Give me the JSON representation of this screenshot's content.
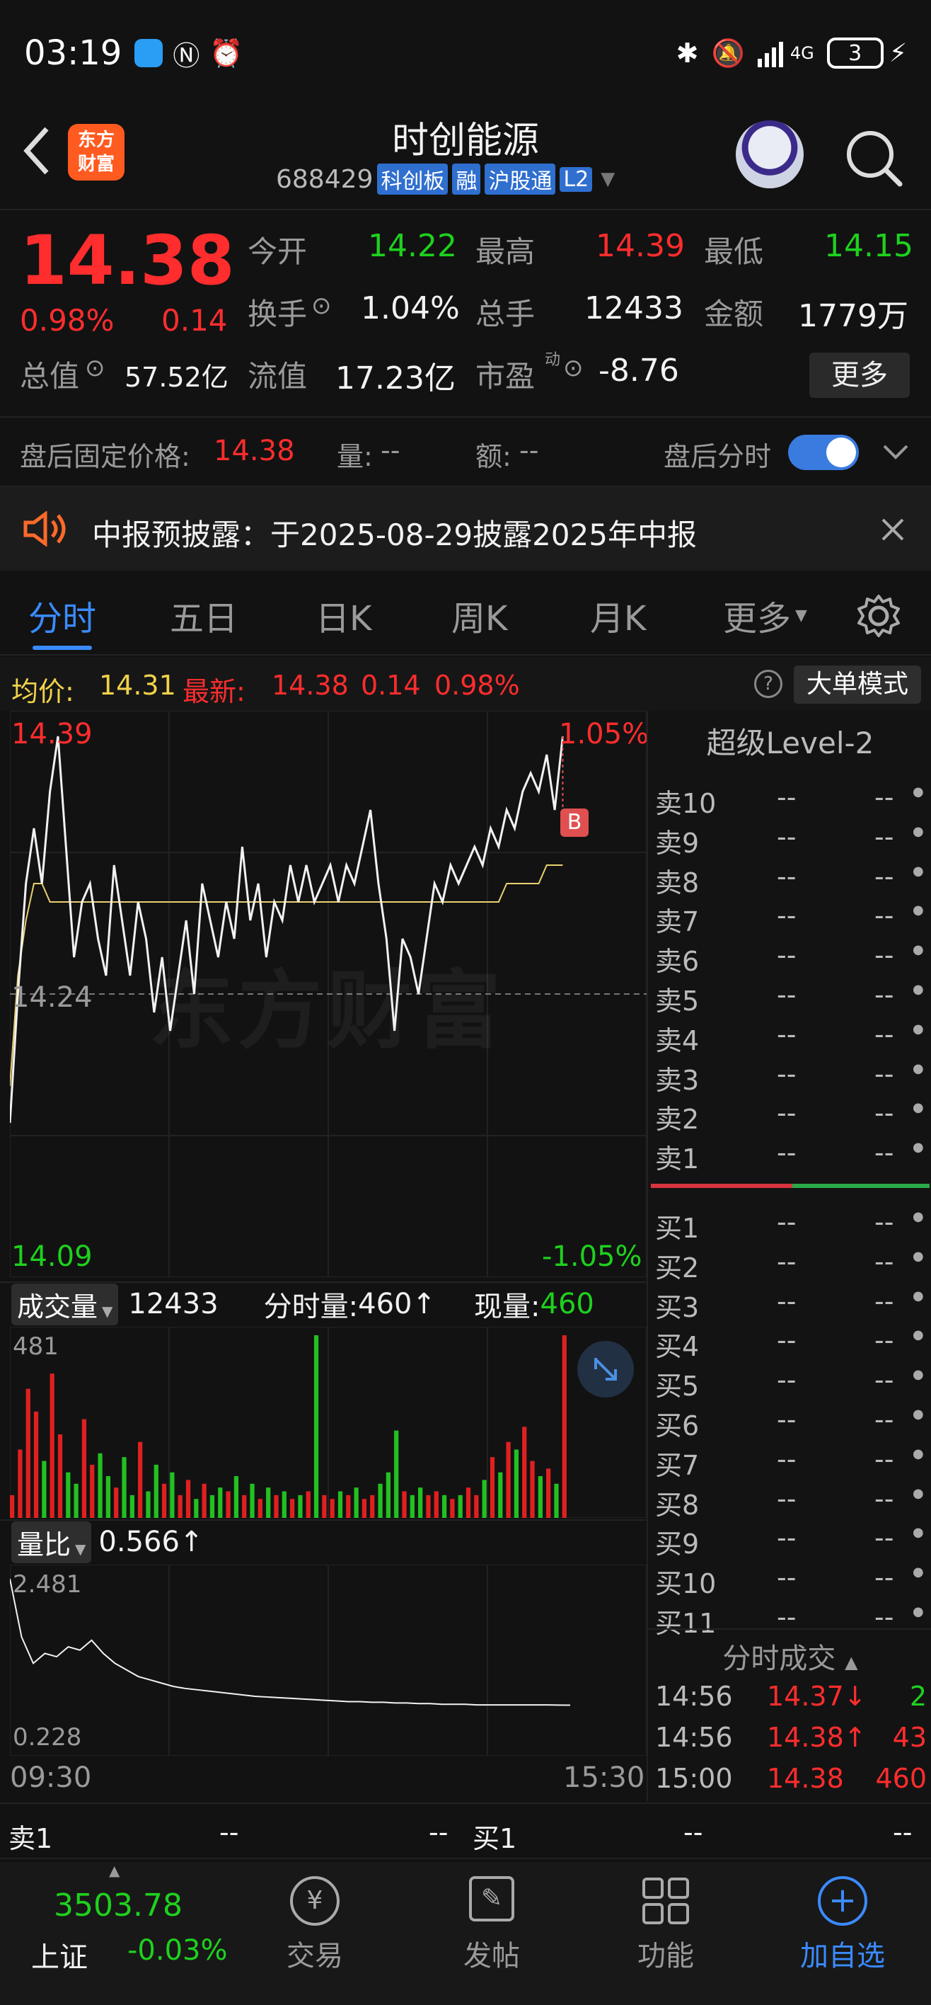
{
  "status": {
    "time": "03:19",
    "battery": "3",
    "network": "4G"
  },
  "header": {
    "title": "时创能源",
    "code": "688429",
    "tags": [
      "科创板",
      "融",
      "沪股通",
      "L2"
    ],
    "logo_line1": "东方",
    "logo_line2": "财富"
  },
  "quote": {
    "price": "14.38",
    "pct": "0.98%",
    "chg": "0.14",
    "open_label": "今开",
    "open": "14.22",
    "high_label": "最高",
    "high": "14.39",
    "low_label": "最低",
    "low": "14.15",
    "turnover_label": "换手",
    "turnover": "1.04%",
    "vol_label": "总手",
    "vol": "12433",
    "amount_label": "金额",
    "amount": "1779万",
    "mcap_label": "总值",
    "mcap": "57.52亿",
    "float_label": "流值",
    "float": "17.23亿",
    "pe_label": "市盈",
    "pe_sup": "动",
    "pe": "-8.76",
    "more": "更多"
  },
  "after": {
    "label": "盘后固定价格:",
    "price": "14.38",
    "vol_label": "量:",
    "vol": "--",
    "amt_label": "额:",
    "amt": "--",
    "toggle_label": "盘后分时"
  },
  "notice": {
    "text": "中报预披露：于2025-08-29披露2025年中报"
  },
  "tabs": [
    "分时",
    "五日",
    "日K",
    "周K",
    "月K",
    "更多"
  ],
  "info": {
    "avg_label": "均价:",
    "avg": "14.31",
    "last_label": "最新:",
    "last": "14.38",
    "chg": "0.14",
    "pct": "0.98%",
    "big_order": "大单模式"
  },
  "chart": {
    "top": "14.39",
    "top_pct": "1.05%",
    "mid": "14.24",
    "bottom": "14.09",
    "bottom_pct": "-1.05%",
    "start": "09:30",
    "end": "15:30",
    "watermark": "东方财富",
    "marker": "B"
  },
  "volume": {
    "label": "成交量",
    "total": "12433",
    "minute_label": "分时量:",
    "minute": "460↑",
    "now_label": "现量:",
    "now": "460",
    "max": "481"
  },
  "ratio": {
    "label": "量比",
    "value": "0.566↑",
    "max": "2.481",
    "min": "0.228"
  },
  "level2": {
    "title": "超级Level-2",
    "asks": [
      "卖10",
      "卖9",
      "卖8",
      "卖7",
      "卖6",
      "卖5",
      "卖4",
      "卖3",
      "卖2",
      "卖1"
    ],
    "bids": [
      "买1",
      "买2",
      "买3",
      "买4",
      "买5",
      "买6",
      "买7",
      "买8",
      "买9",
      "买10",
      "买11"
    ],
    "empty": "--"
  },
  "trades": {
    "title": "分时成交",
    "rows": [
      {
        "t": "14:56",
        "p": "14.37↓",
        "v": "2"
      },
      {
        "t": "14:56",
        "p": "14.38↑",
        "v": "43"
      },
      {
        "t": "15:00",
        "p": "14.38",
        "v": "460"
      }
    ]
  },
  "bottom_quote": {
    "left_label": "卖1",
    "left_a": "--",
    "left_b": "--",
    "right_label": "买1",
    "right_a": "--",
    "right_b": "--"
  },
  "nav": {
    "index_value": "3503.78",
    "index_name": "上证",
    "index_pct": "-0.03%",
    "items": [
      "交易",
      "发帖",
      "功能",
      "加自选"
    ]
  },
  "chart_data": {
    "type": "line",
    "x_range": [
      "09:30",
      "15:30"
    ],
    "ylim": [
      14.09,
      14.39
    ],
    "ref": 14.24,
    "price": [
      14.17,
      14.24,
      14.3,
      14.33,
      14.3,
      14.35,
      14.38,
      14.32,
      14.26,
      14.29,
      14.3,
      14.27,
      14.25,
      14.31,
      14.28,
      14.25,
      14.29,
      14.27,
      14.23,
      14.26,
      14.22,
      14.25,
      14.28,
      14.24,
      14.3,
      14.28,
      14.26,
      14.29,
      14.27,
      14.32,
      14.28,
      14.3,
      14.26,
      14.29,
      14.28,
      14.31,
      14.29,
      14.31,
      14.29,
      14.3,
      14.31,
      14.29,
      14.31,
      14.3,
      14.32,
      14.34,
      14.3,
      14.27,
      14.22,
      14.27,
      14.26,
      14.24,
      14.27,
      14.3,
      14.29,
      14.31,
      14.3,
      14.31,
      14.32,
      14.31,
      14.33,
      14.32,
      14.34,
      14.33,
      14.35,
      14.36,
      14.35,
      14.37,
      14.34,
      14.38
    ],
    "avg": [
      14.19,
      14.25,
      14.28,
      14.3,
      14.3,
      14.29,
      14.29,
      14.29,
      14.29,
      14.29,
      14.29,
      14.29,
      14.29,
      14.29,
      14.29,
      14.29,
      14.29,
      14.29,
      14.29,
      14.29,
      14.29,
      14.29,
      14.29,
      14.29,
      14.29,
      14.29,
      14.29,
      14.29,
      14.29,
      14.29,
      14.29,
      14.29,
      14.29,
      14.29,
      14.29,
      14.29,
      14.29,
      14.29,
      14.29,
      14.29,
      14.29,
      14.29,
      14.29,
      14.29,
      14.29,
      14.29,
      14.29,
      14.29,
      14.29,
      14.29,
      14.29,
      14.29,
      14.29,
      14.29,
      14.29,
      14.29,
      14.29,
      14.29,
      14.29,
      14.29,
      14.29,
      14.29,
      14.3,
      14.3,
      14.3,
      14.3,
      14.3,
      14.31,
      14.31,
      14.31
    ],
    "volume": [
      60,
      180,
      340,
      280,
      150,
      380,
      220,
      120,
      90,
      260,
      140,
      170,
      110,
      80,
      160,
      60,
      200,
      70,
      140,
      90,
      120,
      60,
      100,
      50,
      90,
      60,
      80,
      70,
      110,
      60,
      90,
      50,
      80,
      60,
      70,
      50,
      60,
      70,
      481,
      60,
      50,
      70,
      60,
      80,
      50,
      60,
      90,
      120,
      230,
      70,
      60,
      80,
      60,
      70,
      60,
      50,
      60,
      80,
      60,
      100,
      160,
      120,
      200,
      180,
      240,
      150,
      110,
      130,
      90,
      481
    ],
    "ratio": [
      2.48,
      1.6,
      1.2,
      1.35,
      1.3,
      1.45,
      1.4,
      1.55,
      1.35,
      1.2,
      1.1,
      1.0,
      0.95,
      0.9,
      0.85,
      0.82,
      0.8,
      0.78,
      0.76,
      0.74,
      0.72,
      0.7,
      0.69,
      0.68,
      0.67,
      0.66,
      0.65,
      0.64,
      0.63,
      0.62,
      0.62,
      0.61,
      0.61,
      0.6,
      0.6,
      0.59,
      0.59,
      0.58,
      0.58,
      0.58,
      0.57,
      0.57,
      0.57,
      0.57,
      0.57,
      0.57,
      0.57,
      0.567,
      0.566
    ]
  }
}
